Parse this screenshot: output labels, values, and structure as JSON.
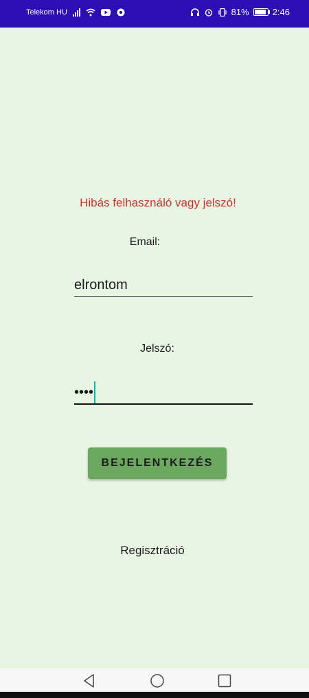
{
  "status_bar": {
    "carrier": "Telekom HU",
    "battery": "81%",
    "time": "2:46",
    "background": "#2b0fb5"
  },
  "screen": {
    "background": "#e8f5e3",
    "error_message": "Hibás felhasználó vagy jelszó!",
    "error_color": "#d32f2f",
    "email_label": "Email:",
    "email_value": "elrontom",
    "password_label": "Jelszó:",
    "password_value": "••••",
    "login_button": "BEJELENTKEZÉS",
    "button_color": "#6aa85f",
    "register_link": "Regisztráció"
  },
  "icons": {
    "status_left": [
      "signal-icon",
      "wifi-icon",
      "youtube-icon",
      "app-icon"
    ],
    "status_right": [
      "headphones-icon",
      "alarm-icon",
      "vibrate-icon",
      "battery-icon"
    ],
    "nav": [
      "back-icon",
      "home-icon",
      "recent-apps-icon"
    ]
  }
}
